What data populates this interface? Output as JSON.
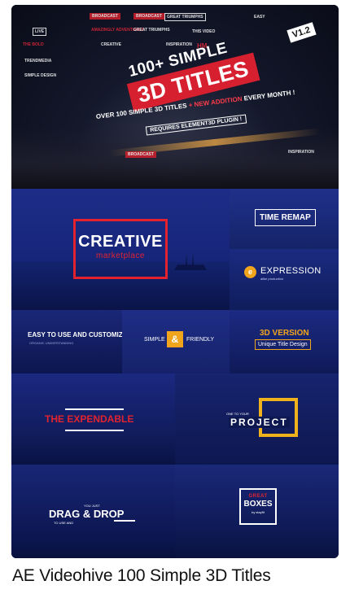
{
  "banner": {
    "version": "V1.2",
    "headline_line1": "100+ SIMPLE",
    "headline_line2": "3D TITLES",
    "subline_part1": "OVER 100 SIMPLE 3D TITLES",
    "subline_accent": "+ NEW ADDITION",
    "subline_part2": "EVERY MONTH !",
    "requirement": "REQUIRES ELEMENT3D PLUGIN !",
    "mini_titles": [
      "BROADCAST",
      "BROADCAST",
      "GREAT TRIUMPHS",
      "LIVE",
      "AMAZINGLY ADVENTURES",
      "GREAT TRIUMPHS",
      "THIS VIDEO",
      "EASY",
      "THE BOLD",
      "INSPIRATION",
      "CREATIVE",
      "SIMPLE DESIGN",
      "HM",
      "TRENDMEDIA",
      "BROADCAST",
      "INSPIRATION"
    ]
  },
  "panels": {
    "creative": {
      "title": "CREATIVE",
      "subtitle": "marketplace"
    },
    "time_remap": {
      "label": "TIME REMAP"
    },
    "expression": {
      "icon_letter": "e",
      "title": "EXPRESSION",
      "subtitle": "alike production"
    },
    "easy": {
      "title": "EASY TO USE AND CUSTOMIZE",
      "subtitle": "ORGANIC UNDERSTANDING"
    },
    "simple": {
      "word1": "SIMPLE",
      "amp": "&",
      "word2": "FRIENDLY"
    },
    "version3d": {
      "title": "3D VERSION",
      "subtitle": "Unique Title Design"
    },
    "expendable": {
      "title": "THE EXPENDABLE"
    },
    "project": {
      "subtitle": "ONE TO YOUR",
      "title": "PROJECT"
    },
    "drag": {
      "subtitle_top": "YOU JUST",
      "title": "DRAG & DROP",
      "subtitle_bottom": "TO USE AND"
    },
    "boxes": {
      "top": "GREAT",
      "main": "BOXES",
      "by": "by stayfit"
    }
  },
  "caption": "AE Videohive 100 Simple 3D Titles"
}
